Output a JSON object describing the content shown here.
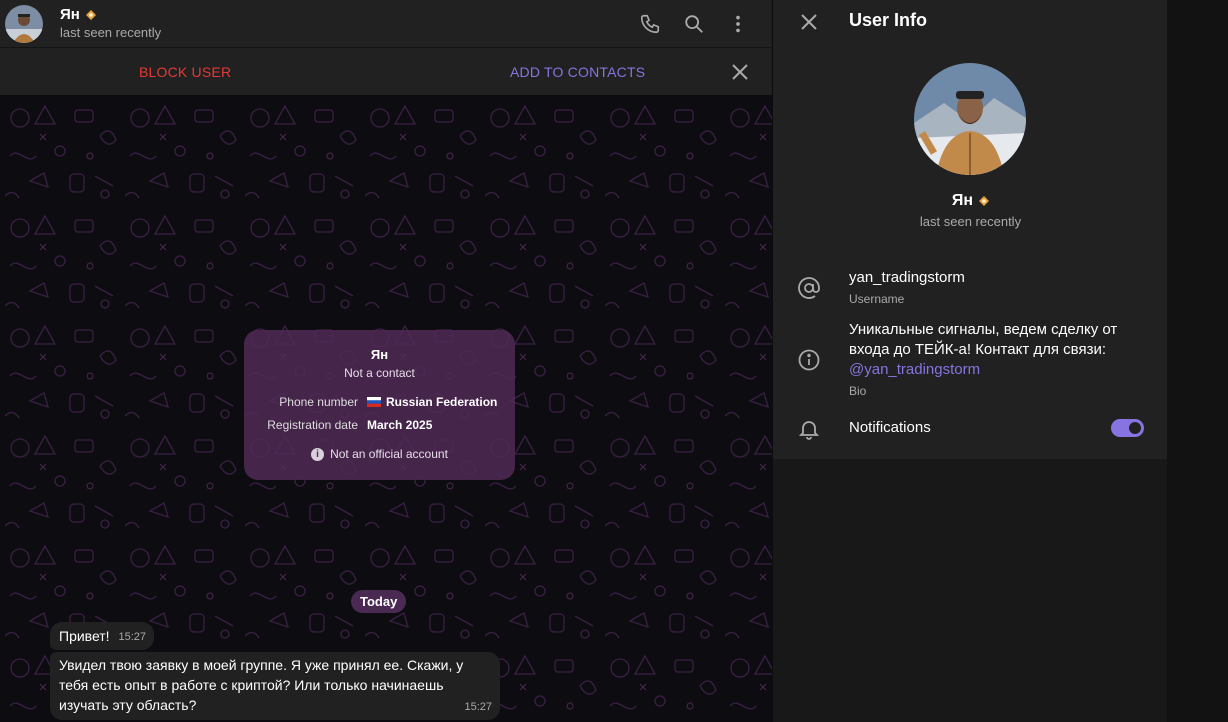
{
  "chat_header": {
    "name": "Ян",
    "status": "last seen recently"
  },
  "action_bar": {
    "block_label": "BLOCK USER",
    "add_label": "ADD TO CONTACTS"
  },
  "info_card": {
    "name": "Ян",
    "subtitle": "Not a contact",
    "phone_label": "Phone number",
    "phone_value": "Russian Federation",
    "reg_label": "Registration date",
    "reg_value": "March 2025",
    "footer": "Not an official account"
  },
  "date_divider": "Today",
  "messages": [
    {
      "text": "Привет!",
      "time": "15:27"
    },
    {
      "text": "Увидел твою заявку в моей группе. Я уже принял ее. Скажи, у тебя есть опыт в работе с криптой? Или только начинаешь изучать эту область?",
      "time": "15:27"
    }
  ],
  "user_info": {
    "title": "User Info",
    "name": "Ян",
    "status": "last seen recently",
    "username": "yan_tradingstorm",
    "username_label": "Username",
    "bio_text": "Уникальные сигналы, ведем сделку от входа до ТЕЙК-а! Контакт для связи:",
    "bio_link": "@yan_tradingstorm",
    "bio_label": "Bio",
    "notifications_label": "Notifications",
    "notifications_on": true
  },
  "colors": {
    "accent": "#8774e1",
    "danger": "#e53935",
    "card": "#522b58"
  }
}
